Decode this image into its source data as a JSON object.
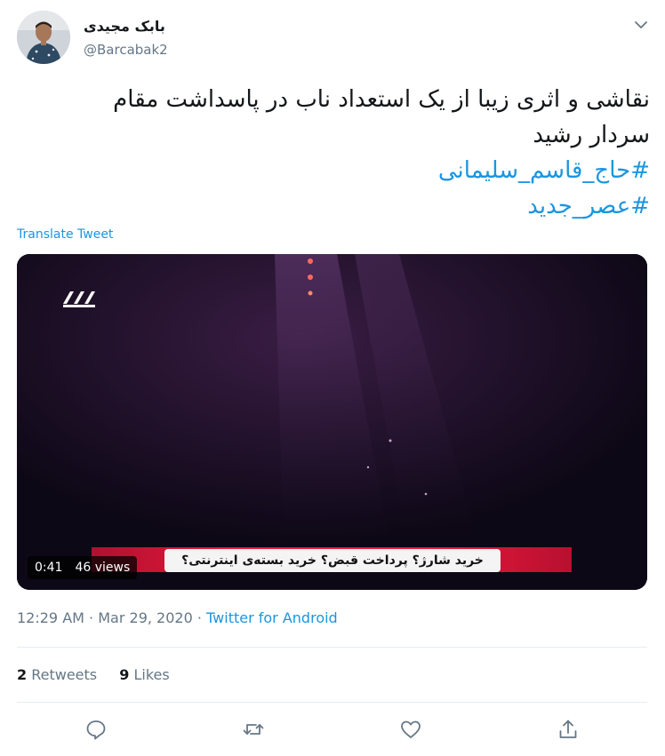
{
  "user": {
    "display_name": "بابک مجیدی",
    "handle": "@Barcabak2"
  },
  "tweet": {
    "line1": "نقاشی و اثری زیبا از یک استعداد ناب  در  پاسداشت مقام",
    "line2": "سردار رشید",
    "hashtag1": "#حاج_قاسم_سلیمانی",
    "hashtag2": "#عصر_جدید",
    "translate_label": "Translate Tweet"
  },
  "media": {
    "duration": "0:41",
    "views": "46 views",
    "ticker_text": "خرید شارژ؟ پرداخت قبض؟ خرید بسته‌ی اینترنتی؟"
  },
  "meta": {
    "time": "12:29 AM",
    "sep1": "·",
    "date": "Mar 29, 2020",
    "sep2": "·",
    "source": "Twitter for Android"
  },
  "stats": {
    "retweets_count": "2",
    "retweets_label": "Retweets",
    "likes_count": "9",
    "likes_label": "Likes"
  },
  "icons": {
    "reply": "reply-icon",
    "retweet": "retweet-icon",
    "like": "heart-icon",
    "share": "share-icon",
    "caret": "chevron-down-icon"
  },
  "colors": {
    "link": "#1b95e0",
    "secondary_text": "#657786",
    "icon": "#657786",
    "divider": "#e6ecf0",
    "ticker_red": "#e8193a"
  }
}
